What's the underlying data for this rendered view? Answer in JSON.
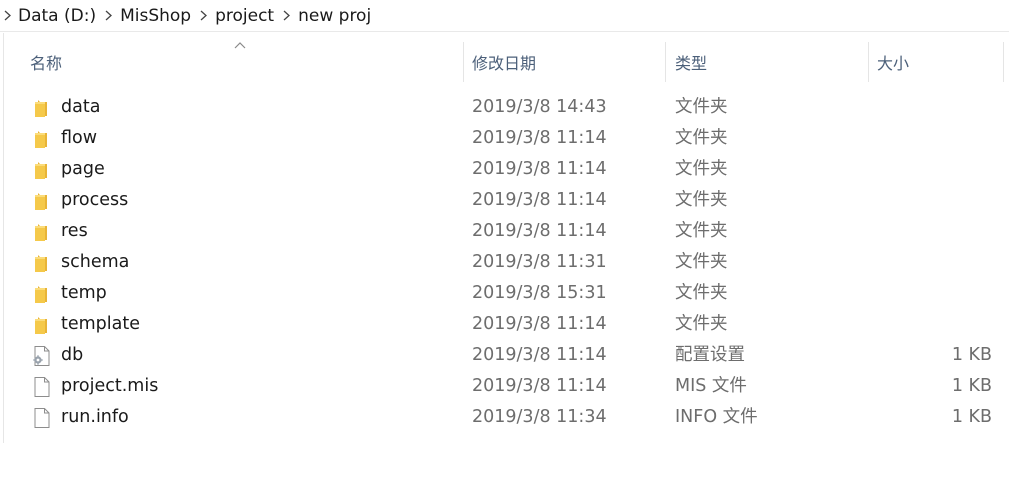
{
  "breadcrumb": {
    "items": [
      "Data (D:)",
      "MisShop",
      "project",
      "new proj"
    ]
  },
  "columns": {
    "name": "名称",
    "date": "修改日期",
    "type": "类型",
    "size": "大小"
  },
  "files": [
    {
      "name": "data",
      "date": "2019/3/8 14:43",
      "type": "文件夹",
      "size": "",
      "icon": "folder-icon"
    },
    {
      "name": "flow",
      "date": "2019/3/8 11:14",
      "type": "文件夹",
      "size": "",
      "icon": "folder-icon"
    },
    {
      "name": "page",
      "date": "2019/3/8 11:14",
      "type": "文件夹",
      "size": "",
      "icon": "folder-icon"
    },
    {
      "name": "process",
      "date": "2019/3/8 11:14",
      "type": "文件夹",
      "size": "",
      "icon": "folder-icon"
    },
    {
      "name": "res",
      "date": "2019/3/8 11:14",
      "type": "文件夹",
      "size": "",
      "icon": "folder-icon"
    },
    {
      "name": "schema",
      "date": "2019/3/8 11:31",
      "type": "文件夹",
      "size": "",
      "icon": "folder-icon"
    },
    {
      "name": "temp",
      "date": "2019/3/8 15:31",
      "type": "文件夹",
      "size": "",
      "icon": "folder-icon"
    },
    {
      "name": "template",
      "date": "2019/3/8 11:14",
      "type": "文件夹",
      "size": "",
      "icon": "folder-icon"
    },
    {
      "name": "db",
      "date": "2019/3/8 11:14",
      "type": "配置设置",
      "size": "1 KB",
      "icon": "config-file-icon"
    },
    {
      "name": "project.mis",
      "date": "2019/3/8 11:14",
      "type": "MIS 文件",
      "size": "1 KB",
      "icon": "file-icon"
    },
    {
      "name": "run.info",
      "date": "2019/3/8 11:34",
      "type": "INFO 文件",
      "size": "1 KB",
      "icon": "file-icon"
    }
  ],
  "colors": {
    "folder": "#f5c94a",
    "header_text": "#4c607a",
    "secondary_text": "#6d6d6d"
  }
}
